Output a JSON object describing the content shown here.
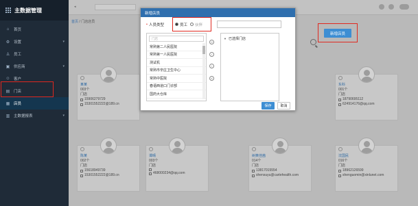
{
  "app": {
    "title": "主数据管理"
  },
  "sidebar": {
    "items": [
      {
        "label": "首页",
        "icon": "home-icon",
        "glyph": "⌂",
        "caret": ""
      },
      {
        "label": "设置",
        "icon": "gear-icon",
        "glyph": "⚙",
        "caret": "▾"
      },
      {
        "label": "员工",
        "icon": "user-icon",
        "glyph": "♙",
        "caret": ""
      },
      {
        "label": "供应商",
        "icon": "truck-icon",
        "glyph": "▣",
        "caret": "▾"
      },
      {
        "label": "客户",
        "icon": "customer-icon",
        "glyph": "☺",
        "caret": ""
      },
      {
        "label": "门店",
        "icon": "store-icon",
        "glyph": "▤",
        "caret": ""
      },
      {
        "label": "店员",
        "icon": "clerk-icon",
        "glyph": "▦",
        "caret": ""
      },
      {
        "label": "主数据报表",
        "icon": "report-icon",
        "glyph": "▥",
        "caret": "▾"
      }
    ],
    "active_index": 6,
    "highlighted_index": 5
  },
  "topbar": {
    "back": "◂"
  },
  "breadcrumb": {
    "home": "首页",
    "current": "门店店员"
  },
  "main": {
    "add_button": "新增店员"
  },
  "cards": [
    {
      "name": "某某",
      "count": "003个",
      "role": "门店",
      "phone": "15906279729",
      "email": "15301552222@189.cn"
    },
    {
      "name": "东科",
      "count": "001个",
      "role": "门店",
      "phone": "18790695112",
      "email": "624914176@qq.com"
    },
    {
      "name": "陈某",
      "count": "002个",
      "role": "门店",
      "phone": "15618949739",
      "email": "15301552222@189.cn"
    },
    {
      "name": "谭晴",
      "count": "003个",
      "role": "门店",
      "phone": "",
      "email": "468000234@qq.com"
    },
    {
      "name": "树黄佳茜",
      "count": "014个",
      "role": "门店",
      "phone": "13817015554",
      "email": "shensuyu@cartehealth.com"
    },
    {
      "name": "沈国民",
      "count": "016个",
      "role": "门店",
      "phone": "18962126599",
      "email": "shenguomin@xinlunet.com"
    }
  ],
  "modal": {
    "title": "新增店员",
    "type_label": "人员类型",
    "required_mark": "•",
    "radio_employee": "员工",
    "radio_partner": "伙伴",
    "left_search_placeholder": "门店",
    "left_items": [
      "常熟第二人民医院",
      "常熟第一人民医院",
      "测试机",
      "常熟市辛庄卫生中心",
      "常熟中医院",
      "春语西道口门诊部",
      "国药大仓库"
    ],
    "arrow_glyphs": [
      "»",
      "›",
      "‹",
      "«"
    ],
    "right_node": "已选择门店",
    "save": "保存",
    "cancel": "取消"
  },
  "colors": {
    "accent": "#3d8ed3",
    "sidebar_bg": "#1f2b38",
    "highlight": "#e0281f",
    "modal_header": "#2f6fae"
  }
}
